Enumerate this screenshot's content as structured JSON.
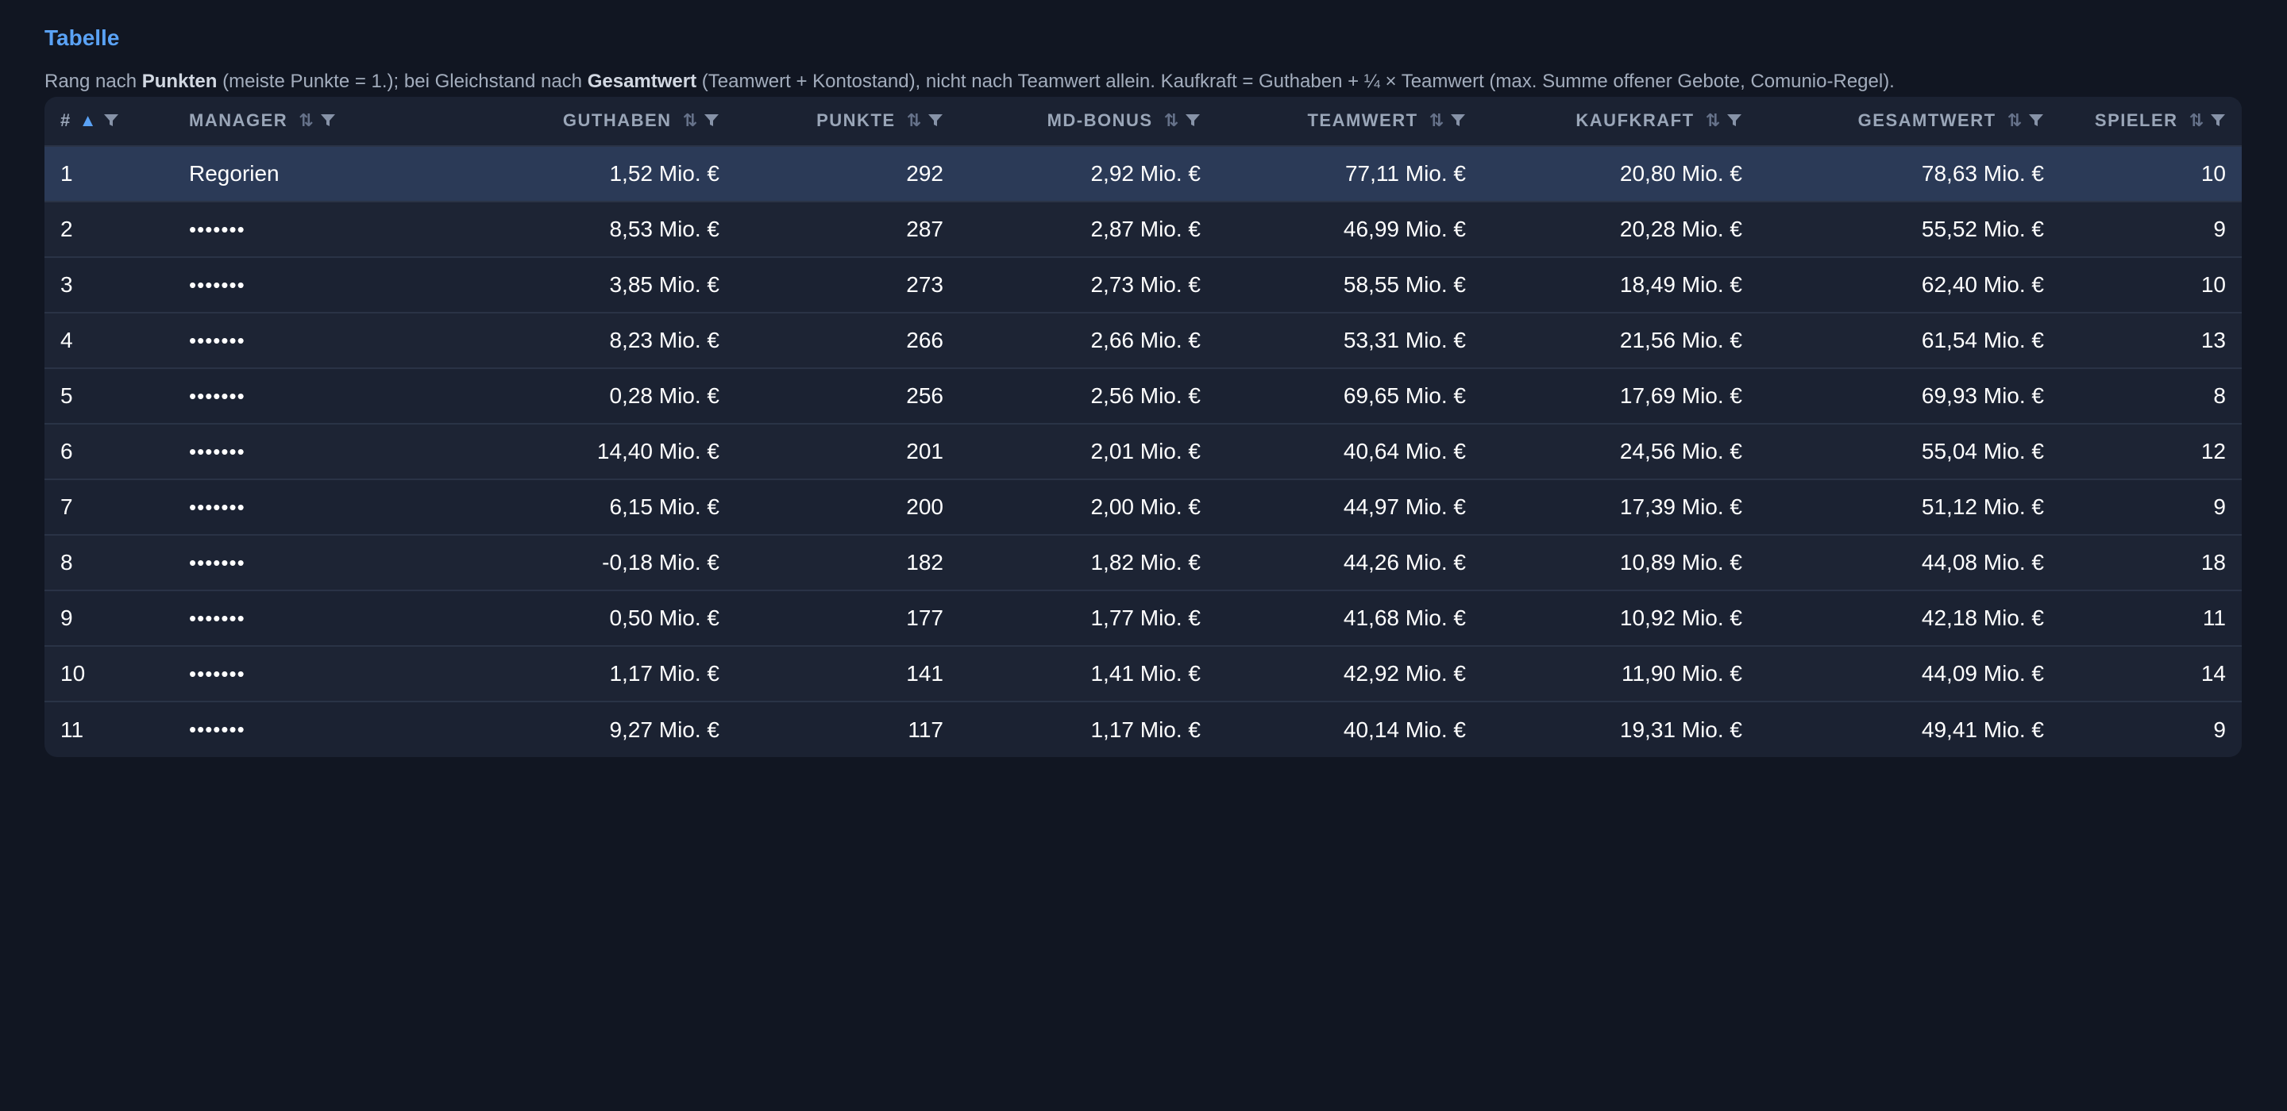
{
  "page": {
    "title": "Tabelle",
    "description": {
      "p1": "Rang nach ",
      "b1": "Punkten",
      "p2": " (meiste Punkte = 1.); bei Gleichstand nach ",
      "b2": "Gesamtwert",
      "p3": " (Teamwert + Kontostand), nicht nach Teamwert allein. Kaufkraft = Guthaben + ¼ × Teamwert (max. Summe offener Gebote, Comunio-Regel)."
    }
  },
  "table": {
    "sort": {
      "column": "#",
      "direction": "ascending"
    },
    "columns": [
      "#",
      "Manager",
      "Guthaben",
      "Punkte",
      "MD-Bonus",
      "Teamwert",
      "Kaufkraft",
      "Gesamtwert",
      "Spieler"
    ],
    "rows": [
      [
        "1",
        "Regorien",
        "1,52 Mio. €",
        "292",
        "2,92 Mio. €",
        "77,11 Mio. €",
        "20,80 Mio. €",
        "78,63 Mio. €",
        "10"
      ],
      [
        "2",
        "•••••••",
        "8,53 Mio. €",
        "287",
        "2,87 Mio. €",
        "46,99 Mio. €",
        "20,28 Mio. €",
        "55,52 Mio. €",
        "9"
      ],
      [
        "3",
        "•••••••",
        "3,85 Mio. €",
        "273",
        "2,73 Mio. €",
        "58,55 Mio. €",
        "18,49 Mio. €",
        "62,40 Mio. €",
        "10"
      ],
      [
        "4",
        "•••••••",
        "8,23 Mio. €",
        "266",
        "2,66 Mio. €",
        "53,31 Mio. €",
        "21,56 Mio. €",
        "61,54 Mio. €",
        "13"
      ],
      [
        "5",
        "•••••••",
        "0,28 Mio. €",
        "256",
        "2,56 Mio. €",
        "69,65 Mio. €",
        "17,69 Mio. €",
        "69,93 Mio. €",
        "8"
      ],
      [
        "6",
        "•••••••",
        "14,40 Mio. €",
        "201",
        "2,01 Mio. €",
        "40,64 Mio. €",
        "24,56 Mio. €",
        "55,04 Mio. €",
        "12"
      ],
      [
        "7",
        "•••••••",
        "6,15 Mio. €",
        "200",
        "2,00 Mio. €",
        "44,97 Mio. €",
        "17,39 Mio. €",
        "51,12 Mio. €",
        "9"
      ],
      [
        "8",
        "•••••••",
        "-0,18 Mio. €",
        "182",
        "1,82 Mio. €",
        "44,26 Mio. €",
        "10,89 Mio. €",
        "44,08 Mio. €",
        "18"
      ],
      [
        "9",
        "•••••••",
        "0,50 Mio. €",
        "177",
        "1,77 Mio. €",
        "41,68 Mio. €",
        "10,92 Mio. €",
        "42,18 Mio. €",
        "11"
      ],
      [
        "10",
        "•••••••",
        "1,17 Mio. €",
        "141",
        "1,41 Mio. €",
        "42,92 Mio. €",
        "11,90 Mio. €",
        "44,09 Mio. €",
        "14"
      ],
      [
        "11",
        "•••••••",
        "9,27 Mio. €",
        "117",
        "1,17 Mio. €",
        "40,14 Mio. €",
        "19,31 Mio. €",
        "49,41 Mio. €",
        "9"
      ]
    ],
    "highlighted_row": 0
  },
  "colors": {
    "background": "#111622",
    "accent": "#5aa2f5",
    "table_bg": "#1b2232",
    "highlight_row": "#2b3a57"
  },
  "icons": {
    "sort_active": "sort-ascending-icon",
    "sort_inactive": "sort-updown-icon",
    "filter": "filter-funnel-icon"
  }
}
